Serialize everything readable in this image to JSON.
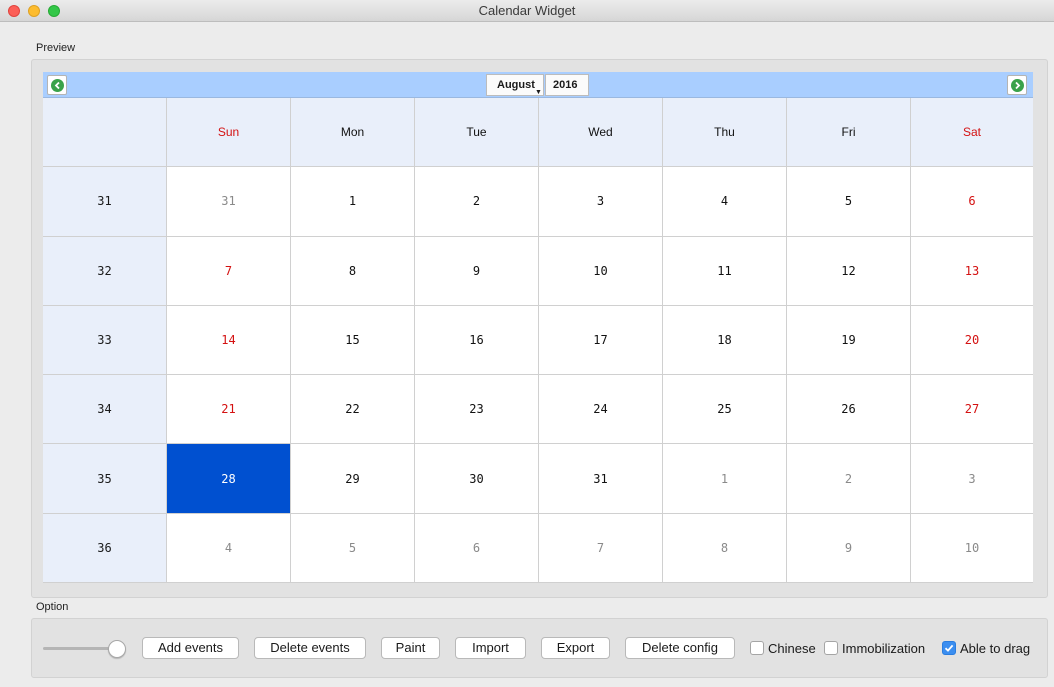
{
  "window": {
    "title": "Calendar Widget"
  },
  "sections": {
    "preview": "Preview",
    "option": "Option"
  },
  "calendar": {
    "month": "August",
    "year": "2016",
    "weekdays": [
      {
        "label": "Sun",
        "weekend": true
      },
      {
        "label": "Mon",
        "weekend": false
      },
      {
        "label": "Tue",
        "weekend": false
      },
      {
        "label": "Wed",
        "weekend": false
      },
      {
        "label": "Thu",
        "weekend": false
      },
      {
        "label": "Fri",
        "weekend": false
      },
      {
        "label": "Sat",
        "weekend": true
      }
    ],
    "selected_day": "28",
    "weeks": [
      {
        "week": "31",
        "days": [
          {
            "d": "31",
            "o": true
          },
          {
            "d": "1",
            "o": false
          },
          {
            "d": "2",
            "o": false
          },
          {
            "d": "3",
            "o": false
          },
          {
            "d": "4",
            "o": false
          },
          {
            "d": "5",
            "o": false
          },
          {
            "d": "6",
            "o": false
          }
        ]
      },
      {
        "week": "32",
        "days": [
          {
            "d": "7",
            "o": false
          },
          {
            "d": "8",
            "o": false
          },
          {
            "d": "9",
            "o": false
          },
          {
            "d": "10",
            "o": false
          },
          {
            "d": "11",
            "o": false
          },
          {
            "d": "12",
            "o": false
          },
          {
            "d": "13",
            "o": false
          }
        ]
      },
      {
        "week": "33",
        "days": [
          {
            "d": "14",
            "o": false
          },
          {
            "d": "15",
            "o": false
          },
          {
            "d": "16",
            "o": false
          },
          {
            "d": "17",
            "o": false
          },
          {
            "d": "18",
            "o": false
          },
          {
            "d": "19",
            "o": false
          },
          {
            "d": "20",
            "o": false
          }
        ]
      },
      {
        "week": "34",
        "days": [
          {
            "d": "21",
            "o": false
          },
          {
            "d": "22",
            "o": false
          },
          {
            "d": "23",
            "o": false
          },
          {
            "d": "24",
            "o": false
          },
          {
            "d": "25",
            "o": false
          },
          {
            "d": "26",
            "o": false
          },
          {
            "d": "27",
            "o": false
          }
        ]
      },
      {
        "week": "35",
        "days": [
          {
            "d": "28",
            "o": false
          },
          {
            "d": "29",
            "o": false
          },
          {
            "d": "30",
            "o": false
          },
          {
            "d": "31",
            "o": false
          },
          {
            "d": "1",
            "o": true
          },
          {
            "d": "2",
            "o": true
          },
          {
            "d": "3",
            "o": true
          }
        ]
      },
      {
        "week": "36",
        "days": [
          {
            "d": "4",
            "o": true
          },
          {
            "d": "5",
            "o": true
          },
          {
            "d": "6",
            "o": true
          },
          {
            "d": "7",
            "o": true
          },
          {
            "d": "8",
            "o": true
          },
          {
            "d": "9",
            "o": true
          },
          {
            "d": "10",
            "o": true
          }
        ]
      }
    ]
  },
  "options": {
    "buttons": {
      "add_events": "Add events",
      "delete_events": "Delete events",
      "paint": "Paint",
      "import": "Import",
      "export": "Export",
      "delete_config": "Delete config"
    },
    "checkboxes": {
      "chinese": {
        "label": "Chinese",
        "checked": false
      },
      "immobilization": {
        "label": "Immobilization",
        "checked": false
      },
      "able_to_drag": {
        "label": "Able to drag",
        "checked": true
      }
    }
  },
  "colors": {
    "weekend_red": "#d41111",
    "selected_blue": "#0050d0",
    "nav_bar_blue": "#a9ceff",
    "header_bg": "#e9effa",
    "nav_green": "#3aa24a"
  },
  "icons": {
    "prev": "arrow-left-circle-icon",
    "next": "arrow-right-circle-icon",
    "month_caret": "caret-down-icon",
    "check": "checkmark-icon"
  }
}
